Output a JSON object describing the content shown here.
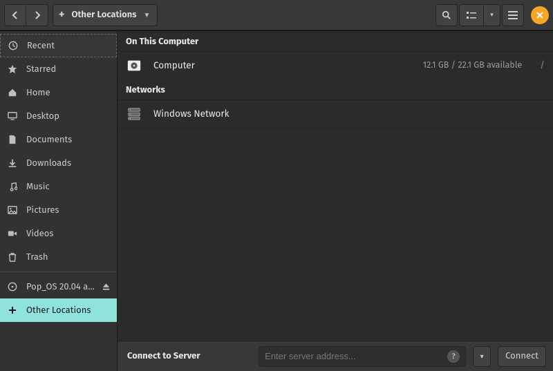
{
  "header": {
    "location_label": "Other Locations"
  },
  "sidebar": {
    "items": [
      {
        "id": "recent",
        "icon": "clock",
        "label": "Recent"
      },
      {
        "id": "starred",
        "icon": "star",
        "label": "Starred"
      },
      {
        "id": "home",
        "icon": "home",
        "label": "Home"
      },
      {
        "id": "desktop",
        "icon": "desktop",
        "label": "Desktop"
      },
      {
        "id": "documents",
        "icon": "document",
        "label": "Documents"
      },
      {
        "id": "downloads",
        "icon": "download",
        "label": "Downloads"
      },
      {
        "id": "music",
        "icon": "music",
        "label": "Music"
      },
      {
        "id": "pictures",
        "icon": "picture",
        "label": "Pictures"
      },
      {
        "id": "videos",
        "icon": "video",
        "label": "Videos"
      },
      {
        "id": "trash",
        "icon": "trash",
        "label": "Trash"
      }
    ],
    "drive": {
      "label": "Pop_OS 20.04 a..."
    },
    "other_locations": {
      "label": "Other Locations"
    }
  },
  "content": {
    "sections": [
      {
        "title": "On This Computer",
        "rows": [
          {
            "icon": "hdd",
            "label": "Computer",
            "info": "12.1 GB  /  22.1 GB available",
            "trailing": "/"
          }
        ]
      },
      {
        "title": "Networks",
        "rows": [
          {
            "icon": "network",
            "label": "Windows Network",
            "info": "",
            "trailing": ""
          }
        ]
      }
    ]
  },
  "connect": {
    "label": "Connect to Server",
    "placeholder": "Enter server address...",
    "button": "Connect"
  }
}
